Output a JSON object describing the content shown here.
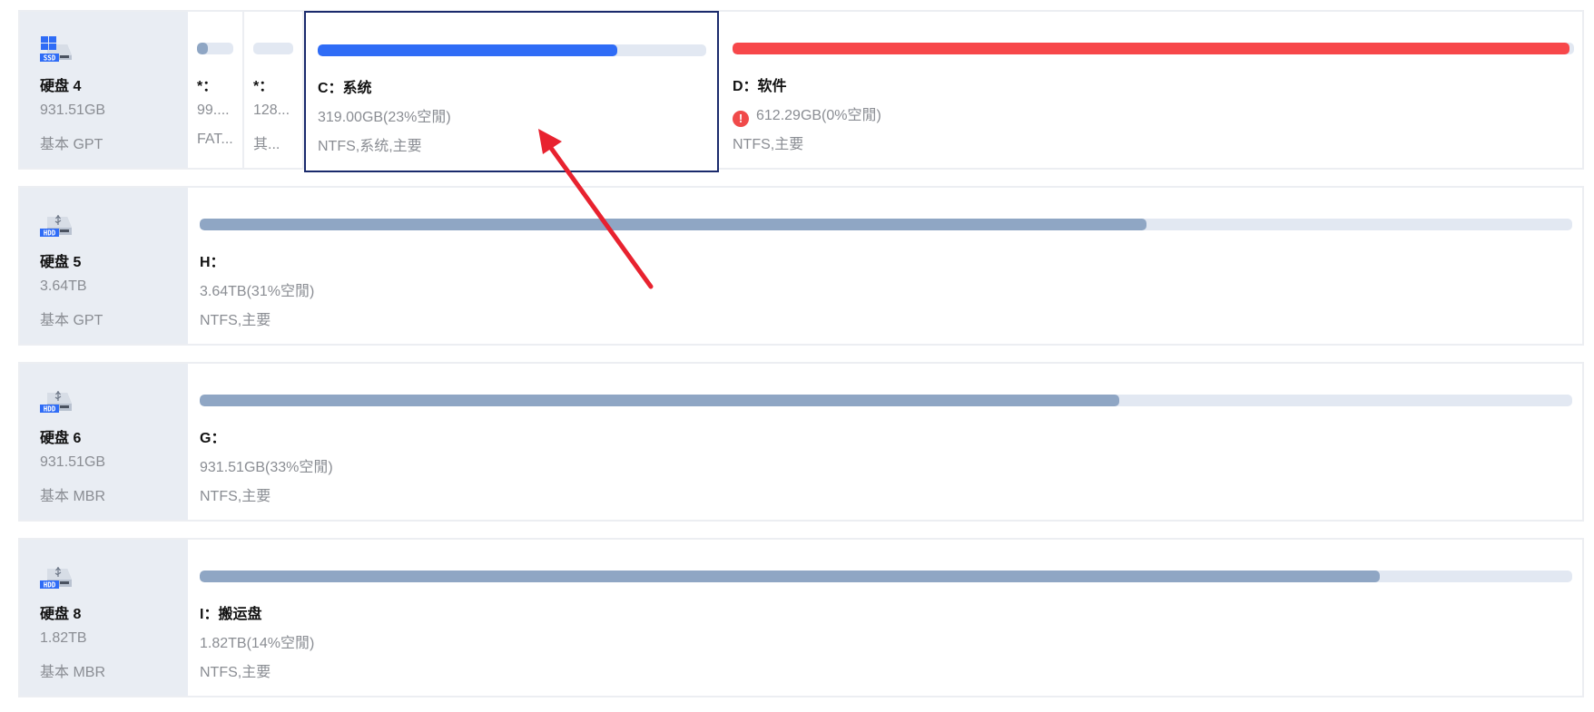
{
  "disks": [
    {
      "name": "硬盘 4",
      "size": "931.51GB",
      "type": "基本 GPT",
      "icon": "ssd-windows-icon",
      "icon_badge": "SSD",
      "partitions": [
        {
          "label": "*：",
          "size": "99....",
          "type": "FAT...",
          "used_fraction": 0.3,
          "color": "#8fa6c4"
        },
        {
          "label": "*：",
          "size": "128...",
          "type": "其...",
          "used_fraction": 0.0,
          "color": "#8fa6c4"
        },
        {
          "label": "C：系统",
          "size": "319.00GB(23%空閒)",
          "type": "NTFS,系统,主要",
          "used_fraction": 0.77,
          "color": "#2f6cf6",
          "selected": true
        },
        {
          "label": "D：软件",
          "size": "612.29GB(0%空閒)",
          "type": "NTFS,主要",
          "used_fraction": 0.995,
          "color": "#f7474a",
          "warning": true
        }
      ]
    },
    {
      "name": "硬盘 5",
      "size": "3.64TB",
      "type": "基本 GPT",
      "icon": "hdd-usb-icon",
      "icon_badge": "HDD",
      "partitions": [
        {
          "label": "H：",
          "size": "3.64TB(31%空閒)",
          "type": "NTFS,主要",
          "used_fraction": 0.69,
          "color": "#8fa6c4"
        }
      ]
    },
    {
      "name": "硬盘 6",
      "size": "931.51GB",
      "type": "基本 MBR",
      "icon": "hdd-usb-icon",
      "icon_badge": "HDD",
      "partitions": [
        {
          "label": "G：",
          "size": "931.51GB(33%空閒)",
          "type": "NTFS,主要",
          "used_fraction": 0.67,
          "color": "#8fa6c4"
        }
      ]
    },
    {
      "name": "硬盘 8",
      "size": "1.82TB",
      "type": "基本 MBR",
      "icon": "hdd-usb-icon",
      "icon_badge": "HDD",
      "partitions": [
        {
          "label": "I：搬运盘",
          "size": "1.82TB(14%空閒)",
          "type": "NTFS,主要",
          "used_fraction": 0.86,
          "color": "#8fa6c4"
        }
      ]
    }
  ],
  "colors": {
    "selected_border": "#1a2a6c",
    "annotation_arrow": "#e8222f",
    "warning": "#f04a4a",
    "track": "#e2e8f2"
  },
  "warning_glyph": "!"
}
